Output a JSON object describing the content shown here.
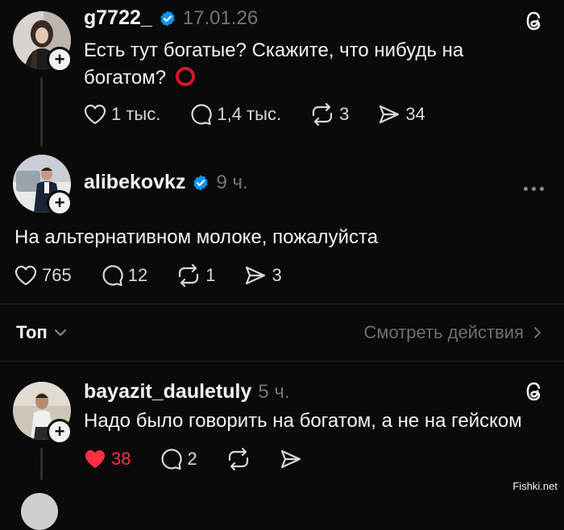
{
  "post1": {
    "username": "g7722_",
    "date": "17.01.26",
    "text": "Есть тут богатые? Скажите, что нибудь на богатом?",
    "likes": "1 тыс.",
    "comments": "1,4 тыс.",
    "reposts": "3",
    "shares": "34"
  },
  "post2": {
    "username": "alibekovkz",
    "time": "9 ч.",
    "text": "На альтернативном молоке, пожалуйста",
    "likes": "765",
    "comments": "12",
    "reposts": "1",
    "shares": "3"
  },
  "sort_bar": {
    "label": "Топ",
    "view_activity": "Смотреть действия"
  },
  "post3": {
    "username": "bayazit_dauletuly",
    "time": "5 ч.",
    "text": "Надо было говорить на богатом, а не на гейском",
    "likes": "38",
    "comments": "2"
  },
  "watermark": "Fishki.net",
  "colors": {
    "background": "#0a0a0a",
    "verified": "#0095f6",
    "liked": "#ff3040",
    "circle_emoji": "#e0102a"
  }
}
